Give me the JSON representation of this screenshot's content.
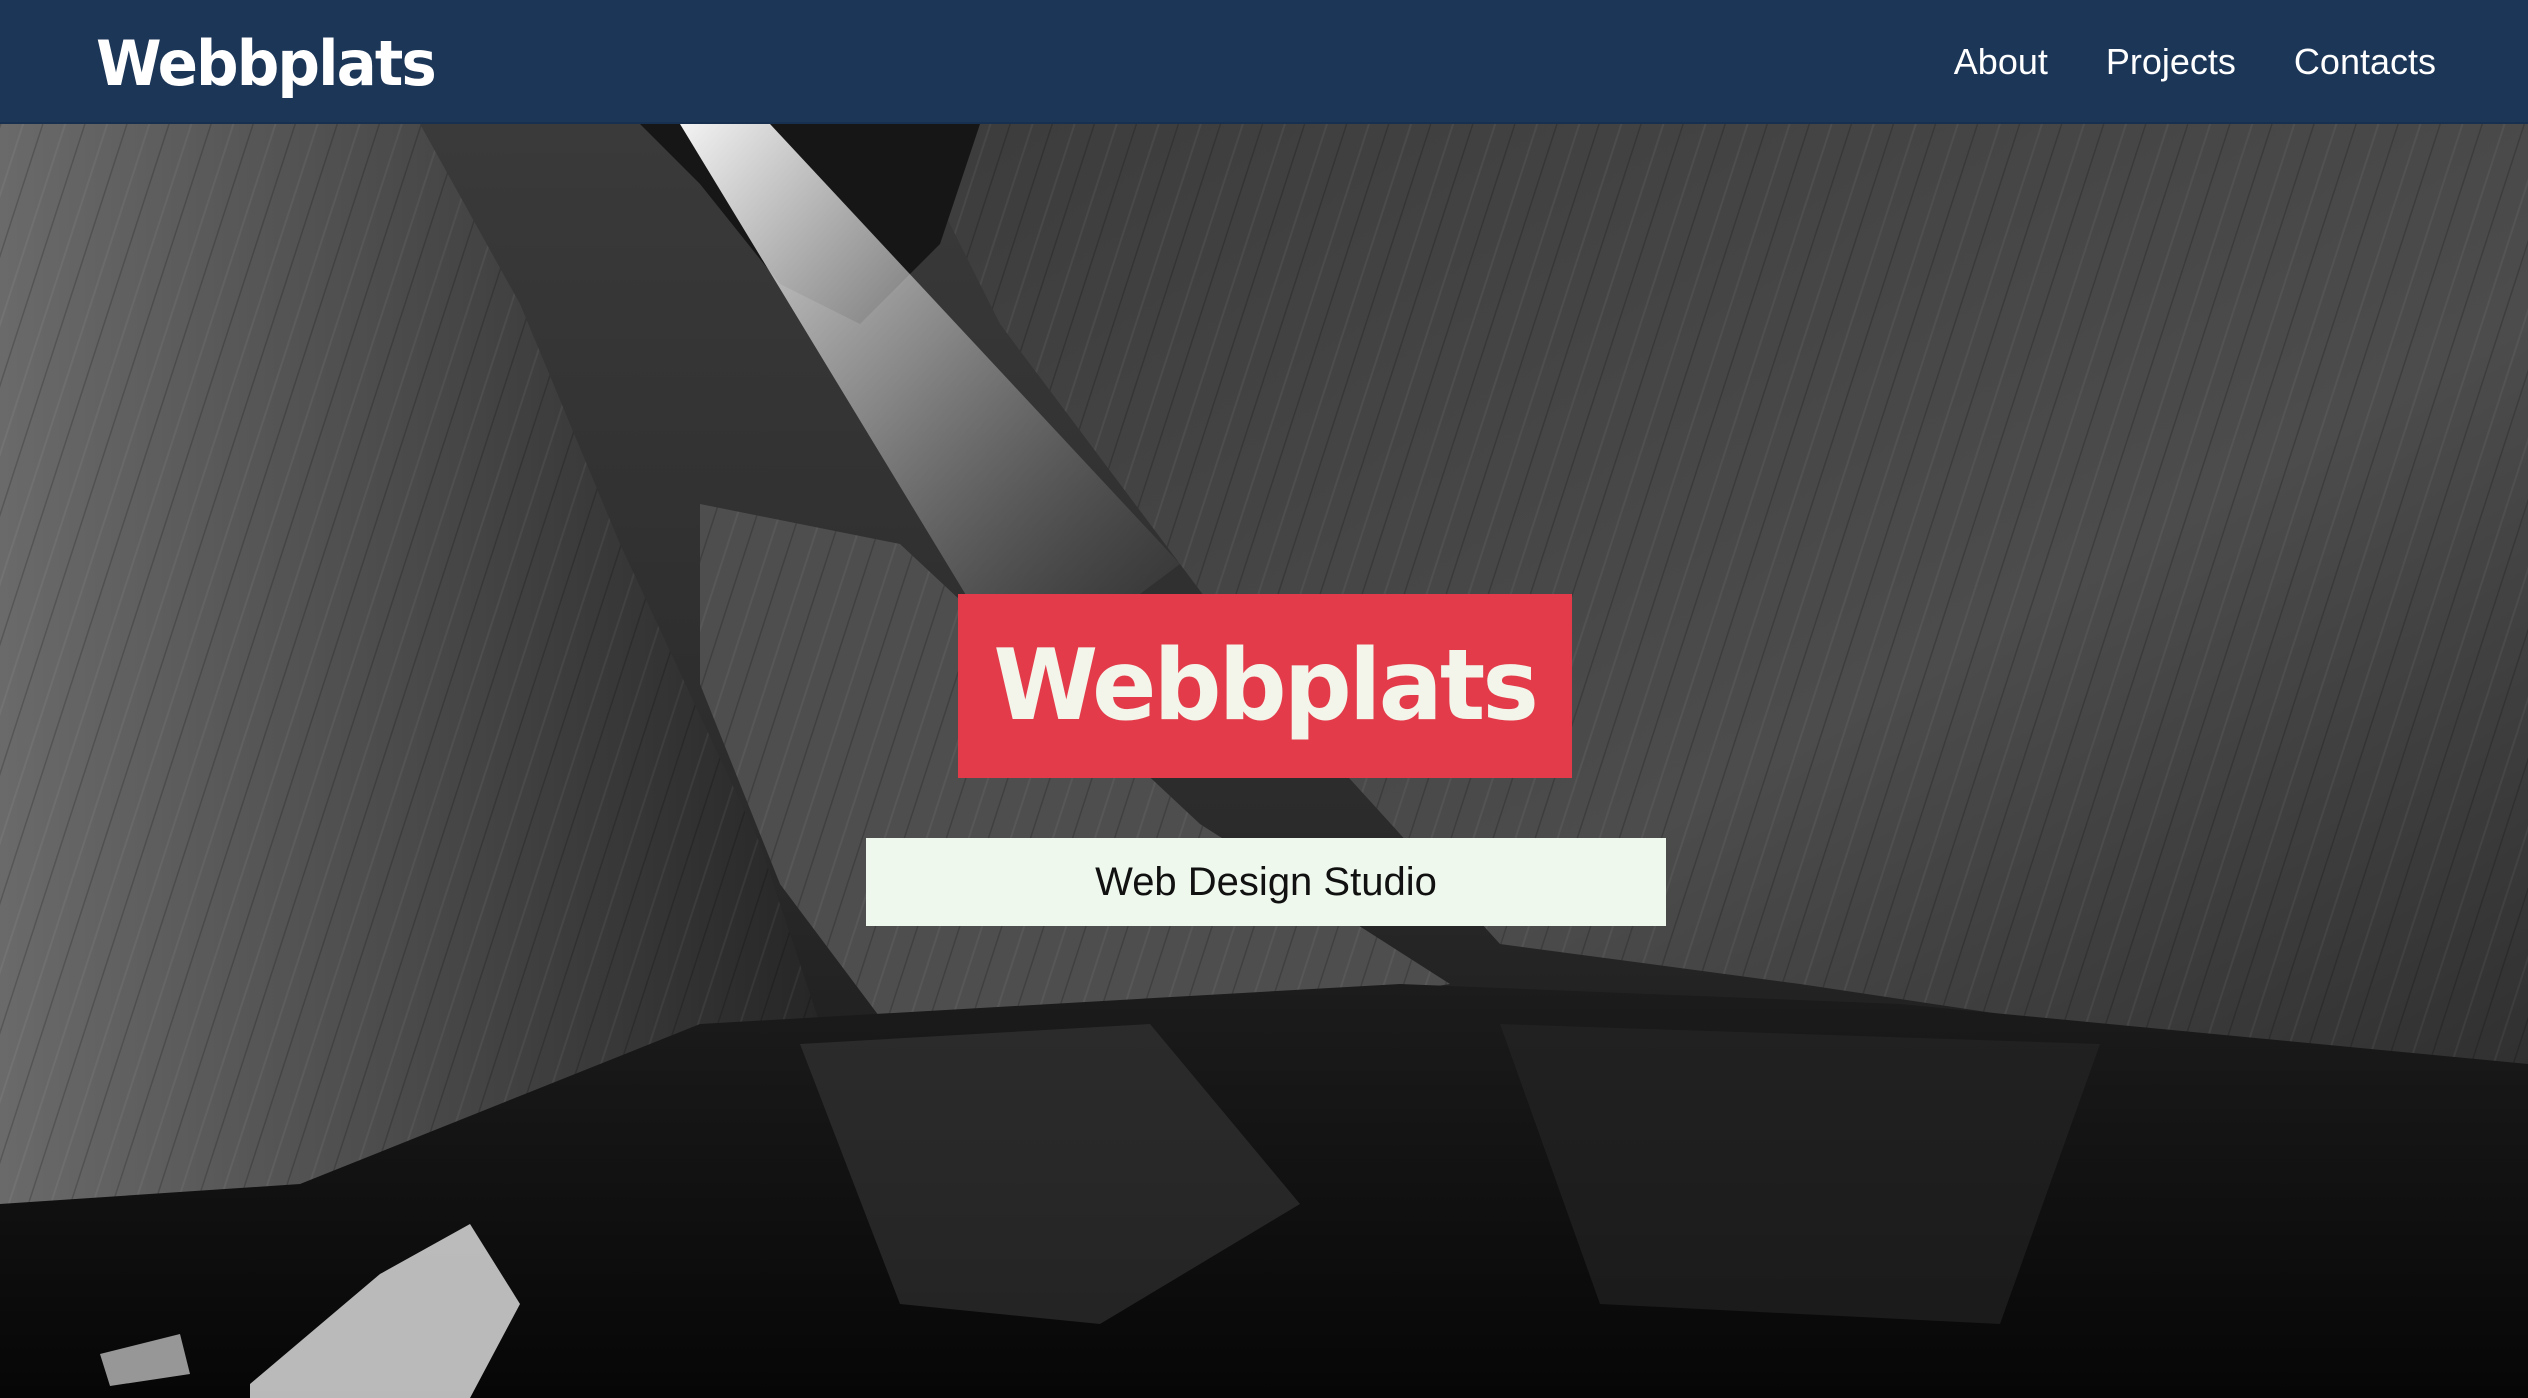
{
  "header": {
    "brand": "Webbplats",
    "nav": [
      {
        "label": "About"
      },
      {
        "label": "Projects"
      },
      {
        "label": "Contacts"
      }
    ]
  },
  "hero": {
    "logo_text": "Webbplats",
    "tagline": "Web Design Studio",
    "background_image": "cave-photo"
  },
  "colors": {
    "header_bg": "#1c3658",
    "logo_box_bg": "#e43b4a",
    "logo_text": "#f3f4ea",
    "tagline_bg": "#eef8ec",
    "tagline_text": "#111111"
  }
}
